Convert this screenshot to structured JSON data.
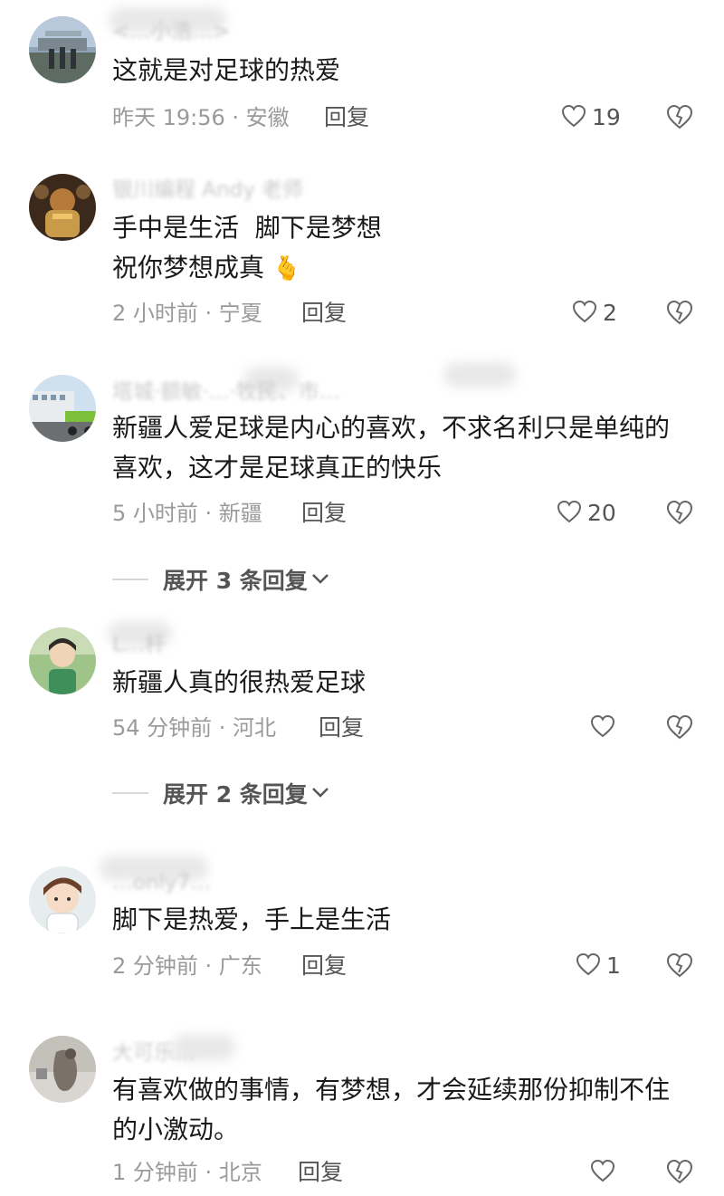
{
  "comments": [
    {
      "username": "<…小浩…>",
      "text": "这就是对足球的热爱",
      "meta": "昨天 19:56 · 安徽",
      "reply": "回复",
      "likes": "19"
    },
    {
      "username": "银川编程 Andy 老师",
      "text": "手中是生活  脚下是梦想\n祝你梦想成真 🫰",
      "meta": "2 小时前 · 宁夏",
      "reply": "回复",
      "likes": "2"
    },
    {
      "username": "塔城·额敏·…·牧民、市…",
      "text": "新疆人爱足球是内心的喜欢，不求名利只是单纯的喜欢，这才是足球真正的快乐",
      "meta": "5 小时前 · 新疆",
      "reply": "回复",
      "likes": "20",
      "expand": "展开 3 条回复"
    },
    {
      "username": "L…杆",
      "text": "新疆人真的很热爱足球",
      "meta": "54 分钟前 · 河北",
      "reply": "回复",
      "likes": "",
      "expand": "展开 2 条回复"
    },
    {
      "username": "…only7…",
      "text": "脚下是热爱，手上是生活",
      "meta": "2 分钟前 · 广东",
      "reply": "回复",
      "likes": "1"
    },
    {
      "username": "大可乐…",
      "text": "有喜欢做的事情，有梦想，才会延续那份抑制不住的小激动。",
      "meta": "1 分钟前 · 北京",
      "reply": "回复",
      "likes": ""
    }
  ],
  "colors": {
    "text": "#1a1a1a",
    "meta": "#9a9a9a",
    "action": "#555555",
    "username": "#c9c9c9"
  },
  "icons": {
    "like": "heart-outline-icon",
    "dislike": "broken-heart-icon",
    "expand": "chevron-down-icon"
  }
}
